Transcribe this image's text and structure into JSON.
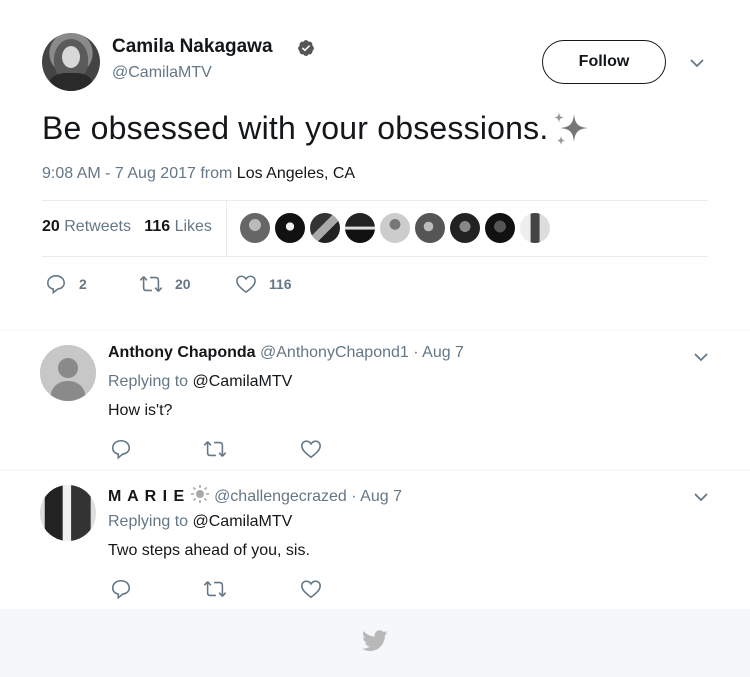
{
  "tweet": {
    "author_name": "Camila Nakagawa",
    "author_handle": "@CamilaMTV",
    "verified_icon": "verified-badge-icon",
    "follow_label": "Follow",
    "text": "Be obsessed with your obsessions.",
    "emoji_icon": "sparkles-icon",
    "time": "9:08 AM - 7 Aug 2017",
    "from_label": "from",
    "location": "Los Angeles, CA",
    "retweets_count": "20",
    "retweets_label": "Retweets",
    "likes_count": "116",
    "likes_label": "Likes",
    "reply_count": "2",
    "retweet_action_count": "20",
    "like_action_count": "116"
  },
  "replies": [
    {
      "name": "Anthony Chaponda",
      "handle": "@AnthonyChapond1",
      "date": "· Aug 7",
      "replying_label": "Replying to",
      "replying_to": "@CamilaMTV",
      "text": "How is't?"
    },
    {
      "name": "M A R I E",
      "name_icon": "sun-icon",
      "handle": "@challengecrazed",
      "date": "· Aug 7",
      "replying_label": "Replying to",
      "replying_to": "@CamilaMTV",
      "text": "Two steps ahead of you, sis."
    }
  ],
  "colors": {
    "primary_text": "#14171a",
    "secondary_text": "#657786",
    "border": "#e6ecf0",
    "background_alt": "#f5f8fa"
  }
}
